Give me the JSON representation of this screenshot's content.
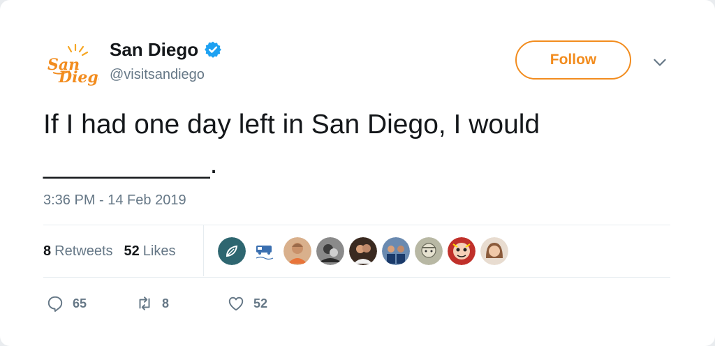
{
  "account": {
    "name": "San Diego",
    "handle": "@visitsandiego",
    "verified": true,
    "avatar_icon": "san-diego-logo-icon",
    "brand_color": "#f28c1e"
  },
  "follow_button": {
    "label": "Follow"
  },
  "menu": {
    "icon": "chevron-down-icon"
  },
  "tweet": {
    "text_line1": "If I had one day left in San Diego, I would",
    "text_line2": "___________.",
    "timestamp": "3:36 PM - 14 Feb 2019"
  },
  "stats": {
    "retweets_count": "8",
    "retweets_label": "Retweets",
    "likes_count": "52",
    "likes_label": "Likes"
  },
  "likers": [
    {
      "name": "liker-1",
      "color": "#2e6670"
    },
    {
      "name": "liker-2",
      "color": "#ffffff"
    },
    {
      "name": "liker-3",
      "color": "#c9916a"
    },
    {
      "name": "liker-4",
      "color": "#3c3c3c"
    },
    {
      "name": "liker-5",
      "color": "#5a3a2a"
    },
    {
      "name": "liker-6",
      "color": "#2a4a7a"
    },
    {
      "name": "liker-7",
      "color": "#8a8a7a"
    },
    {
      "name": "liker-8",
      "color": "#c0302a"
    },
    {
      "name": "liker-9",
      "color": "#8a5a3a"
    }
  ],
  "actions": {
    "reply_count": "65",
    "retweet_count": "8",
    "like_count": "52"
  }
}
